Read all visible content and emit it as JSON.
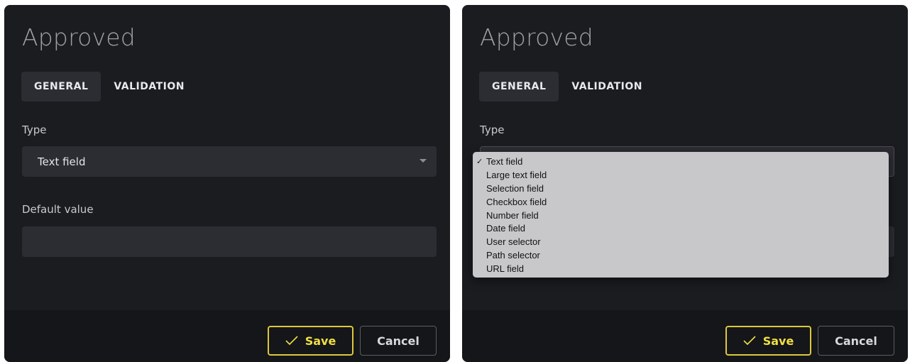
{
  "left_panel": {
    "title": "Approved",
    "tabs": [
      {
        "label": "GENERAL",
        "active": true
      },
      {
        "label": "VALIDATION",
        "active": false
      }
    ],
    "type_label": "Type",
    "type_value": "Text field",
    "default_label": "Default value",
    "default_value": "",
    "save_label": "Save",
    "cancel_label": "Cancel"
  },
  "right_panel": {
    "title": "Approved",
    "tabs": [
      {
        "label": "GENERAL",
        "active": true
      },
      {
        "label": "VALIDATION",
        "active": false
      }
    ],
    "type_label": "Type",
    "save_label": "Save",
    "cancel_label": "Cancel",
    "dropdown": {
      "selected": "Text field",
      "options": [
        "Text field",
        "Large text field",
        "Selection field",
        "Checkbox field",
        "Number field",
        "Date field",
        "User selector",
        "Path selector",
        "URL field"
      ]
    }
  },
  "colors": {
    "panel_bg": "#1b1c20",
    "field_bg": "#2c2d33",
    "footer_bg": "#151619",
    "save_accent": "#dcc93a",
    "dropdown_bg": "#c8c8ca"
  },
  "icons": {
    "save": "check-icon",
    "select": "caret-down-icon",
    "selected_option": "checkmark-icon"
  }
}
